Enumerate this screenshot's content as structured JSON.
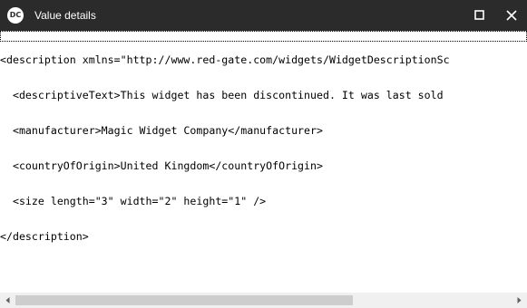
{
  "window": {
    "title": "Value details",
    "app_icon_text": "DC"
  },
  "editor": {
    "lines": [
      "<description xmlns=\"http://www.red-gate.com/widgets/WidgetDescriptionSc",
      "  <descriptiveText>This widget has been discontinued. It was last sold",
      "  <manufacturer>Magic Widget Company</manufacturer>",
      "  <countryOfOrigin>United Kingdom</countryOfOrigin>",
      "  <size length=\"3\" width=\"2\" height=\"1\" />",
      "</description>"
    ]
  },
  "scrollbar": {
    "thumb_position": 0.0,
    "thumb_fraction": 0.68
  },
  "icons": {
    "maximize": "maximize-icon",
    "close": "close-icon",
    "scroll_left": "chevron-left-icon",
    "scroll_right": "chevron-right-icon"
  },
  "colors": {
    "titlebar_bg": "#2b2b2b",
    "titlebar_text": "#ffffff",
    "editor_bg": "#ffffff",
    "editor_text": "#000000",
    "scrollbar_track": "#f0f0f0",
    "scrollbar_thumb": "#cdcdcd"
  }
}
